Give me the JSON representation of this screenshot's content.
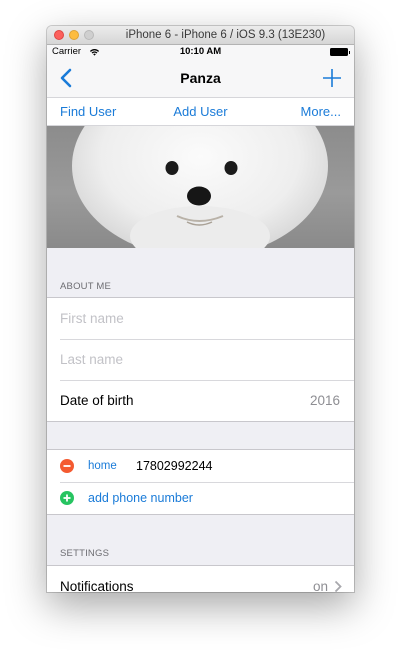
{
  "window": {
    "title": "iPhone 6 - iPhone 6 / iOS 9.3 (13E230)"
  },
  "status_bar": {
    "carrier": "Carrier",
    "time": "10:10 AM"
  },
  "nav": {
    "title": "Panza",
    "back_icon": "chevron-left-icon",
    "add_icon": "plus-icon"
  },
  "tabs": [
    {
      "label": "Find User"
    },
    {
      "label": "Add User"
    },
    {
      "label": "More..."
    }
  ],
  "about": {
    "header": "ABOUT ME",
    "first_name": {
      "placeholder": "First name",
      "value": ""
    },
    "last_name": {
      "placeholder": "Last name",
      "value": ""
    },
    "date_of_birth": {
      "label": "Date of birth",
      "value": "2016"
    }
  },
  "phones": {
    "entries": [
      {
        "type": "home",
        "number": "17802992244"
      }
    ],
    "add_label": "add phone number"
  },
  "settings": {
    "header": "SETTINGS",
    "notifications": {
      "label": "Notifications",
      "value": "on"
    }
  },
  "colors": {
    "tint": "#1a7bd8",
    "remove": "#f45a30",
    "add": "#27c461",
    "background": "#efeff4"
  }
}
